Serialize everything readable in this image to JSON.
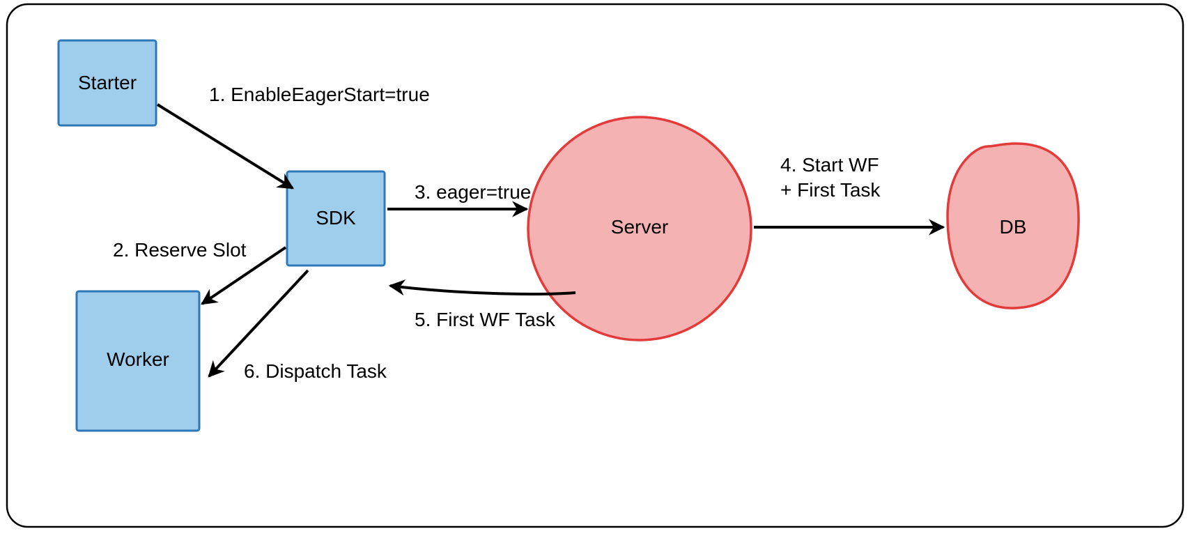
{
  "nodes": {
    "starter": "Starter",
    "sdk": "SDK",
    "worker": "Worker",
    "server": "Server",
    "db": "DB"
  },
  "arrows": {
    "a1": "1. EnableEagerStart=true",
    "a2": "2. Reserve Slot",
    "a3": "3. eager=true",
    "a4_line1": "4. Start WF",
    "a4_line2": "+ First Task",
    "a5": "5. First WF Task",
    "a6": "6. Dispatch Task"
  },
  "colors": {
    "blueFill": "#9fceed",
    "blueStroke": "#2e78b7",
    "redFill": "#f5b2b2",
    "redStroke": "#e33a3a"
  }
}
